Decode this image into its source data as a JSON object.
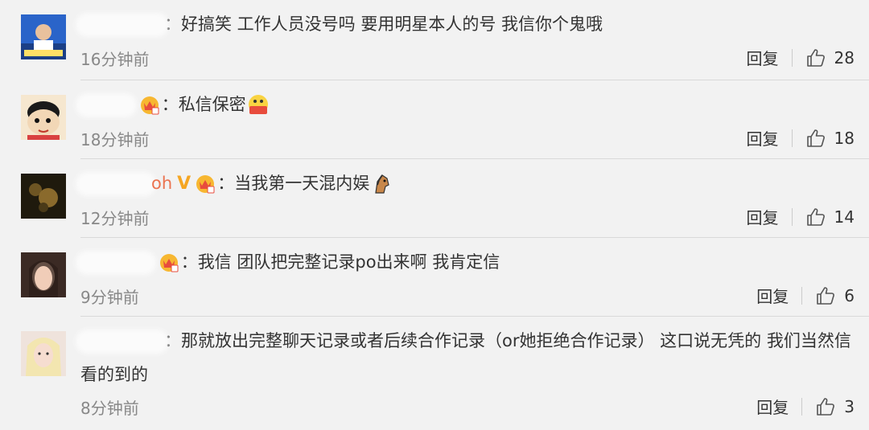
{
  "comments": [
    {
      "text": "好搞笑 工作人员没号吗 要用明星本人的号 我信你个鬼哦",
      "time": "16分钟前",
      "reply_label": "回复",
      "likes": "28",
      "avatar_color": "#2a64c9",
      "has_vip": false,
      "has_badge": false,
      "emoji": "none"
    },
    {
      "text": "私信保密",
      "time": "18分钟前",
      "reply_label": "回复",
      "likes": "18",
      "avatar_color": "#f2d7b6",
      "has_vip": false,
      "has_badge": true,
      "emoji": "hu-fen-emoji"
    },
    {
      "text": "当我第一天混内娱",
      "username_visible": "oh",
      "time": "12分钟前",
      "reply_label": "回复",
      "likes": "14",
      "avatar_color": "#2b2410",
      "has_vip": true,
      "has_badge": true,
      "emoji": "horse-emoji"
    },
    {
      "text": "我信 团队把完整记录po出来啊 我肯定信",
      "time": "9分钟前",
      "reply_label": "回复",
      "likes": "6",
      "avatar_color": "#6b4a3f",
      "has_vip": false,
      "has_badge": true,
      "emoji": "none"
    },
    {
      "text": "那就放出完整聊天记录或者后续合作记录（or她拒绝合作记录） 这口说无凭的 我们当然信看的到的",
      "time": "8分钟前",
      "reply_label": "回复",
      "likes": "3",
      "avatar_color": "#e8d6cf",
      "has_vip": false,
      "has_badge": false,
      "emoji": "none"
    }
  ],
  "colors": {
    "background": "#f2f2f2",
    "username": "#eb7350",
    "meta": "#888888",
    "divider": "#d9d9d9"
  }
}
